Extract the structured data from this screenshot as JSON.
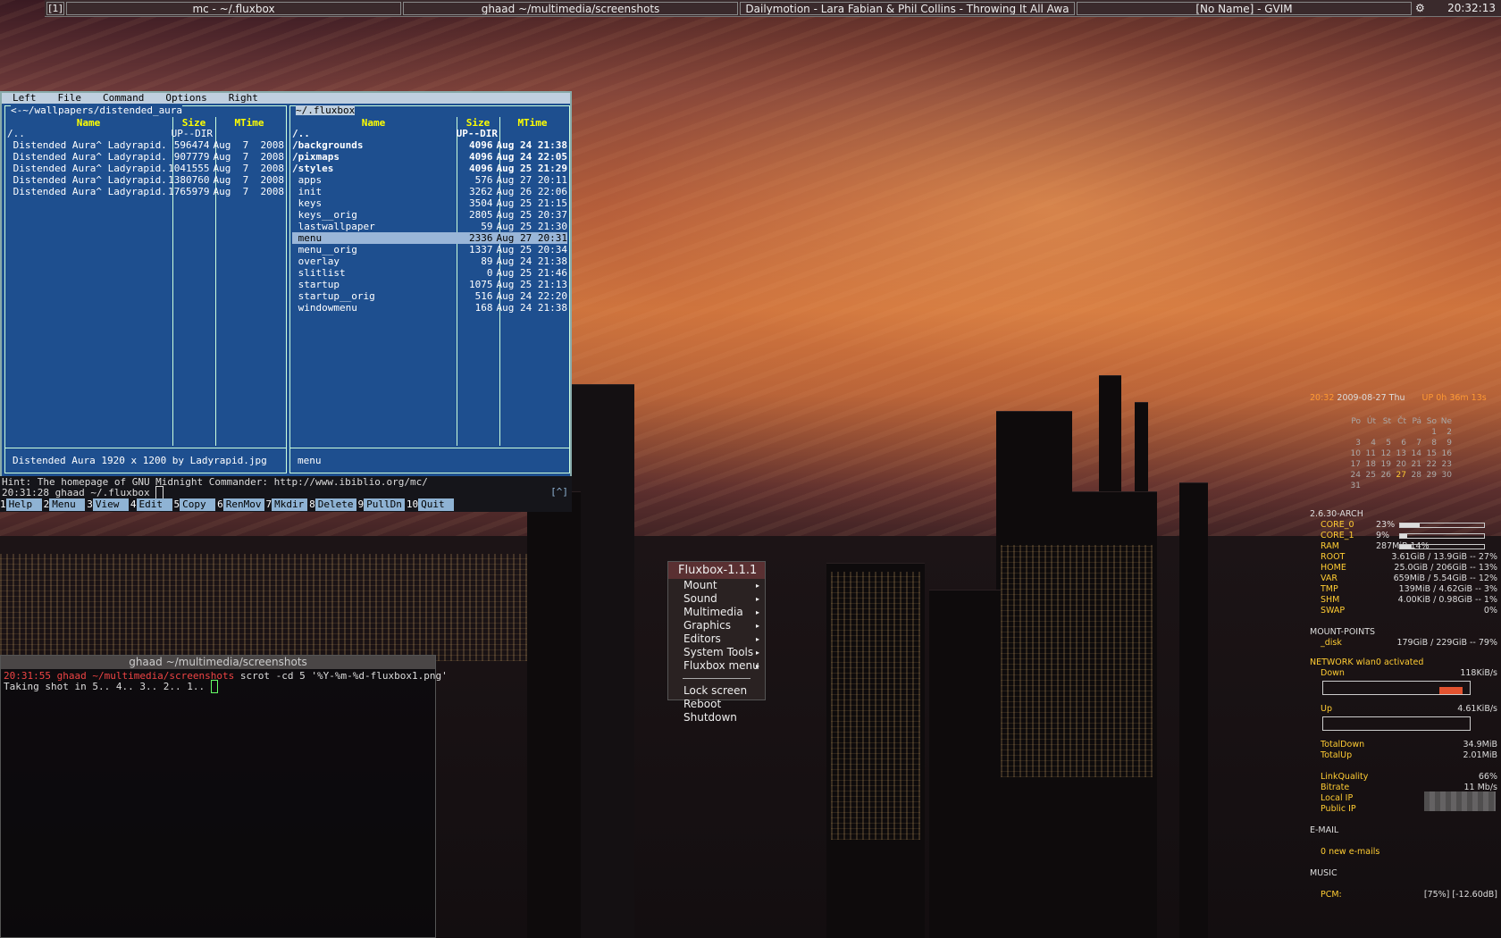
{
  "taskbar": {
    "workspace": "[1]",
    "tasks": [
      "mc - ~/.fluxbox",
      "ghaad ~/multimedia/screenshots",
      "Dailymotion - Lara Fabian & Phil Collins - Throwing It All Awa",
      "[No Name] - GVIM"
    ],
    "clock": "20:32:13"
  },
  "mc": {
    "menu": [
      "Left",
      "File",
      "Command",
      "Options",
      "Right"
    ],
    "left_panel": {
      "path": "<-~/wallpapers/distended_aura",
      "nav": "v>",
      "headers": [
        "Name",
        "Size",
        "MTime"
      ],
      "rows": [
        {
          "name": "/..",
          "size": "UP--DIR",
          "time": ""
        },
        {
          "name": " Distended Aura^ Ladyrapid.jpg",
          "size": "596474",
          "time": "Aug  7  2008"
        },
        {
          "name": " Distended Aura^ Ladyrapid.jpg",
          "size": "907779",
          "time": "Aug  7  2008"
        },
        {
          "name": " Distended Aura^ Ladyrapid.jpg",
          "size": "1041555",
          "time": "Aug  7  2008"
        },
        {
          "name": " Distended Aura^ Ladyrapid.jpg",
          "size": "1380760",
          "time": "Aug  7  2008"
        },
        {
          "name": " Distended Aura^ Ladyrapid.jpg",
          "size": "1765979",
          "time": "Aug  7  2008"
        }
      ],
      "mini": "Distended Aura 1920 x 1200 by Ladyrapid.jpg"
    },
    "right_panel": {
      "path": "~/.fluxbox",
      "nav": "v>",
      "headers": [
        "Name",
        "Size",
        "MTime"
      ],
      "rows": [
        {
          "name": "/..",
          "size": "UP--DIR",
          "time": "",
          "dir": true
        },
        {
          "name": "/backgrounds",
          "size": "4096",
          "time": "Aug 24 21:38",
          "dir": true
        },
        {
          "name": "/pixmaps",
          "size": "4096",
          "time": "Aug 24 22:05",
          "dir": true
        },
        {
          "name": "/styles",
          "size": "4096",
          "time": "Aug 25 21:29",
          "dir": true
        },
        {
          "name": " apps",
          "size": "576",
          "time": "Aug 27 20:11"
        },
        {
          "name": " init",
          "size": "3262",
          "time": "Aug 26 22:06"
        },
        {
          "name": " keys",
          "size": "3504",
          "time": "Aug 25 21:15"
        },
        {
          "name": " keys__orig",
          "size": "2805",
          "time": "Aug 25 20:37"
        },
        {
          "name": " lastwallpaper",
          "size": "59",
          "time": "Aug 25 21:30"
        },
        {
          "name": " menu",
          "size": "2336",
          "time": "Aug 27 20:31",
          "sel": true
        },
        {
          "name": " menu__orig",
          "size": "1337",
          "time": "Aug 25 20:34"
        },
        {
          "name": " overlay",
          "size": "89",
          "time": "Aug 24 21:38"
        },
        {
          "name": " slitlist",
          "size": "0",
          "time": "Aug 25 21:46"
        },
        {
          "name": " startup",
          "size": "1075",
          "time": "Aug 25 21:13"
        },
        {
          "name": " startup__orig",
          "size": "516",
          "time": "Aug 24 22:20"
        },
        {
          "name": " windowmenu",
          "size": "168",
          "time": "Aug 24 21:38"
        }
      ],
      "mini": "menu"
    },
    "hint": "Hint: The homepage of GNU Midnight Commander: http://www.ibiblio.org/mc/",
    "prompt": "20:31:28 ghaad ~/.fluxbox ",
    "corner": "[^]",
    "fkeys": [
      {
        "n": "1",
        "label": "Help"
      },
      {
        "n": "2",
        "label": "Menu"
      },
      {
        "n": "3",
        "label": "View"
      },
      {
        "n": "4",
        "label": "Edit"
      },
      {
        "n": "5",
        "label": "Copy"
      },
      {
        "n": "6",
        "label": "RenMov"
      },
      {
        "n": "7",
        "label": "Mkdir"
      },
      {
        "n": "8",
        "label": "Delete"
      },
      {
        "n": "9",
        "label": "PullDn"
      },
      {
        "n": "10",
        "label": "Quit"
      }
    ]
  },
  "terminal": {
    "title": "ghaad ~/multimedia/screenshots",
    "line1_prefix": "20:31:55 ghaad ~/multimedia/screenshots",
    "line1_cmd": " scrot -cd 5 '%Y-%m-%d-fluxbox1.png'",
    "line2": "Taking shot in 5.. 4.. 3.. 2.. 1.. "
  },
  "fluxbox_menu": {
    "title": "Fluxbox-1.1.1",
    "submenus": [
      "Mount",
      "Sound",
      "Multimedia",
      "Graphics",
      "Editors",
      "System Tools",
      "Fluxbox menu"
    ],
    "actions": [
      "Lock screen",
      "Reboot",
      "Shutdown"
    ]
  },
  "conky": {
    "time": "20:32",
    "date": "2009-08-27 Thu",
    "uptime": "UP 0h 36m 13s",
    "cal_head": [
      "Po",
      "Út",
      "St",
      "Čt",
      "Pá",
      "So",
      "Ne"
    ],
    "cal_rows": [
      [
        "",
        "",
        "",
        "",
        "",
        "1",
        "2"
      ],
      [
        "3",
        "4",
        "5",
        "6",
        "7",
        "8",
        "9"
      ],
      [
        "10",
        "11",
        "12",
        "13",
        "14",
        "15",
        "16"
      ],
      [
        "17",
        "18",
        "19",
        "20",
        "21",
        "22",
        "23"
      ],
      [
        "24",
        "25",
        "26",
        "27",
        "28",
        "29",
        "30"
      ],
      [
        "31",
        "",
        "",
        "",
        "",
        "",
        ""
      ]
    ],
    "today": "27",
    "kernel": "2.6.30-ARCH",
    "sys": [
      {
        "k": "CORE_0",
        "v": "23%",
        "bar": 0.23
      },
      {
        "k": "CORE_1",
        "v": "9%",
        "bar": 0.09
      },
      {
        "k": "RAM",
        "v": "287MiB 14%",
        "bar": 0.14
      }
    ],
    "disks": [
      {
        "k": "ROOT",
        "v": "3.61GiB / 13.9GiB -- 27%"
      },
      {
        "k": "HOME",
        "v": "25.0GiB / 206GiB -- 13%"
      },
      {
        "k": "VAR",
        "v": "659MiB / 5.54GiB -- 12%"
      },
      {
        "k": "TMP",
        "v": "139MiB / 4.62GiB -- 3%"
      },
      {
        "k": "SHM",
        "v": "4.00KiB / 0.98GiB -- 1%"
      },
      {
        "k": "SWAP",
        "v": "0%"
      }
    ],
    "mount_head": "MOUNT-POINTS",
    "mount": {
      "k": "_disk",
      "v": "179GiB / 229GiB -- 79%"
    },
    "net_head": "NETWORK wlan0 activated",
    "down": {
      "k": "Down",
      "v": "118KiB/s"
    },
    "up": {
      "k": "Up",
      "v": "4.61KiB/s"
    },
    "totals": [
      {
        "k": "TotalDown",
        "v": "34.9MiB"
      },
      {
        "k": "TotalUp",
        "v": "2.01MiB"
      }
    ],
    "wifi": [
      {
        "k": "LinkQuality",
        "v": "66%"
      },
      {
        "k": "Bitrate",
        "v": "11 Mb/s"
      },
      {
        "k": "Local IP",
        "v": ""
      },
      {
        "k": "Public IP",
        "v": ""
      }
    ],
    "email_head": "E-MAIL",
    "email": "0 new e-mails",
    "music_head": "MUSIC",
    "pcm": {
      "k": "PCM:",
      "v": "[75%] [-12.60dB]"
    }
  }
}
